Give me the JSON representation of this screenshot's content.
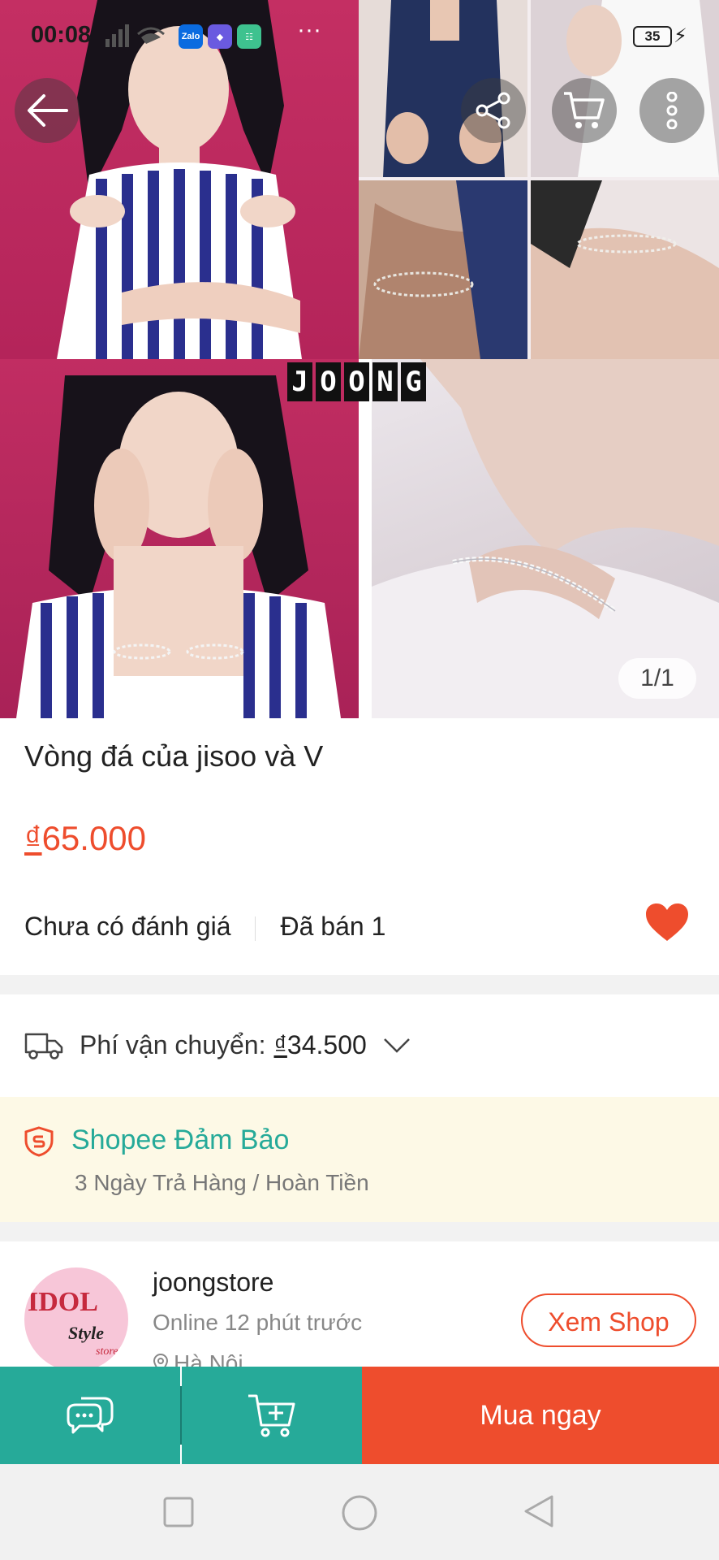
{
  "status_bar": {
    "time": "00:08",
    "apps": [
      "Zalo",
      "",
      ""
    ],
    "more": "···",
    "battery": "35"
  },
  "gallery": {
    "watermark": [
      "J",
      "O",
      "O",
      "N",
      "G"
    ],
    "pager": "1/1"
  },
  "product": {
    "title": "Vòng đá của jisoo và V",
    "currency": "₫",
    "price": "65.000",
    "rating": "Chưa có đánh giá",
    "sold": "Đã bán 1"
  },
  "shipping": {
    "label": "Phí vận chuyển:",
    "currency": "₫",
    "amount": "34.500"
  },
  "guarantee": {
    "title": "Shopee Đảm Bảo",
    "subtitle": "3 Ngày Trả Hàng / Hoàn Tiền"
  },
  "shop": {
    "avatar_text": [
      "IDOL",
      "Style",
      "store"
    ],
    "name": "joongstore",
    "online": "Online 12 phút trước",
    "location": "Hà Nội",
    "view_button": "Xem Shop"
  },
  "bottom_bar": {
    "buy_now": "Mua ngay"
  },
  "colors": {
    "accent": "#ee4d2d",
    "teal": "#26aa99",
    "guarantee_bg": "#fdf9e6"
  }
}
